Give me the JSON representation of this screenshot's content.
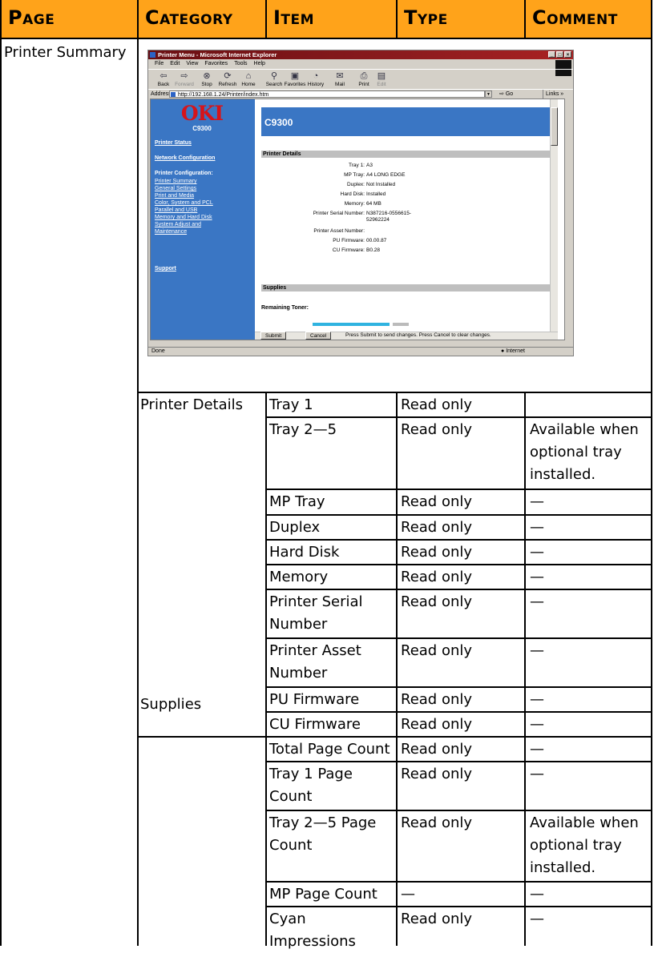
{
  "table": {
    "headers": [
      "Page",
      "Category",
      "Item",
      "Type",
      "Comment"
    ],
    "page_name": "Printer Summary",
    "categories": [
      "Printer Details",
      "Supplies"
    ],
    "rows": [
      {
        "item": [
          "Tray 1"
        ],
        "type": "Read only",
        "comment": []
      },
      {
        "item": [
          "Tray 2—5"
        ],
        "type": "Read only",
        "comment": [
          "Available when",
          "optional tray",
          "installed."
        ]
      },
      {
        "item": [
          "MP Tray"
        ],
        "type": "Read only",
        "comment": [
          "—"
        ]
      },
      {
        "item": [
          "Duplex"
        ],
        "type": "Read only",
        "comment": [
          "—"
        ]
      },
      {
        "item": [
          "Hard Disk"
        ],
        "type": "Read only",
        "comment": [
          "—"
        ]
      },
      {
        "item": [
          "Memory"
        ],
        "type": "Read only",
        "comment": [
          "—"
        ]
      },
      {
        "item": [
          "Printer Serial",
          "Number"
        ],
        "type": "Read only",
        "comment": [
          "—"
        ]
      },
      {
        "item": [
          "Printer Asset",
          "Number"
        ],
        "type": "Read only",
        "comment": [
          "—"
        ]
      },
      {
        "item": [
          "PU Firmware"
        ],
        "type": "Read only",
        "comment": [
          "—"
        ]
      },
      {
        "item": [
          "CU Firmware"
        ],
        "type": "Read only",
        "comment": [
          "—"
        ]
      },
      {
        "item": [
          "Total Page Count"
        ],
        "type": "Read only",
        "comment": [
          "—"
        ]
      },
      {
        "item": [
          "Tray 1 Page",
          "Count"
        ],
        "type": "Read only",
        "comment": [
          "—"
        ]
      },
      {
        "item": [
          "Tray 2—5 Page",
          "Count"
        ],
        "type": "Read only",
        "comment": [
          "Available when",
          "optional tray",
          "installed."
        ]
      },
      {
        "item": [
          "MP Page Count"
        ],
        "type": "—",
        "comment": [
          "—"
        ]
      },
      {
        "item": [
          "Cyan",
          "Impressions"
        ],
        "type": "Read only",
        "comment": [
          "—"
        ]
      }
    ]
  },
  "screenshot": {
    "window_title": "Printer Menu - Microsoft Internet Explorer",
    "window_buttons": [
      "_",
      "□",
      "×"
    ],
    "menu": [
      "File",
      "Edit",
      "View",
      "Favorites",
      "Tools",
      "Help"
    ],
    "toolbar": [
      {
        "label": "Back",
        "glyph": "⇦",
        "enabled": true
      },
      {
        "label": "Forward",
        "glyph": "⇨",
        "enabled": false
      },
      {
        "label": "Stop",
        "glyph": "⊗",
        "enabled": true
      },
      {
        "label": "Refresh",
        "glyph": "⟳",
        "enabled": true
      },
      {
        "label": "Home",
        "glyph": "⌂",
        "enabled": true
      },
      {
        "label": "Search",
        "glyph": "⚲",
        "enabled": true
      },
      {
        "label": "Favorites",
        "glyph": "▣",
        "enabled": true
      },
      {
        "label": "History",
        "glyph": "◔",
        "enabled": true
      },
      {
        "label": "Mail",
        "glyph": "✉",
        "enabled": true
      },
      {
        "label": "Print",
        "glyph": "⎙",
        "enabled": true
      },
      {
        "label": "Edit",
        "glyph": "▤",
        "enabled": false
      }
    ],
    "address_label": "Address",
    "address_value": "http://192.168.1.24/Printer/index.htm",
    "go_label": "Go",
    "links_label": "Links »",
    "logo": "OKI",
    "model": "C9300",
    "nav": {
      "printer_status": "Printer Status",
      "network_configuration": "Network Configuration",
      "printer_configuration": "Printer Configuration:",
      "links": [
        "Printer Summary",
        "General Settings",
        "Print and Media",
        "Color, System and PCL",
        "Parallel and USB",
        "Memory and Hard Disk",
        "System Adjust and",
        "Maintenance"
      ],
      "support": "Support"
    },
    "banner": "C9300",
    "details_heading": "Printer Details",
    "details": [
      {
        "k": "Tray 1:",
        "v": "A3"
      },
      {
        "k": "MP Tray:",
        "v": "A4 LONG EDGE"
      },
      {
        "k": "Duplex:",
        "v": "Not Installed"
      },
      {
        "k": "Hard Disk:",
        "v": "Installed"
      },
      {
        "k": "Memory:",
        "v": "64 MB"
      },
      {
        "k": "Printer Serial Number:",
        "v": "N387216-0556615-"
      },
      {
        "k": "",
        "v": "52962224"
      },
      {
        "k": "Printer Asset Number:",
        "v": ""
      },
      {
        "k": "PU Firmware:",
        "v": "00.00.87"
      },
      {
        "k": "CU Firmware:",
        "v": "B0.28"
      }
    ],
    "supplies_heading": "Supplies",
    "remaining_toner": "Remaining Toner:",
    "submit": "Submit",
    "cancel": "Cancel",
    "submit_note": "Press Submit to send changes. Press Cancel to clear changes.",
    "status_done": "Done",
    "status_zone": "Internet"
  }
}
